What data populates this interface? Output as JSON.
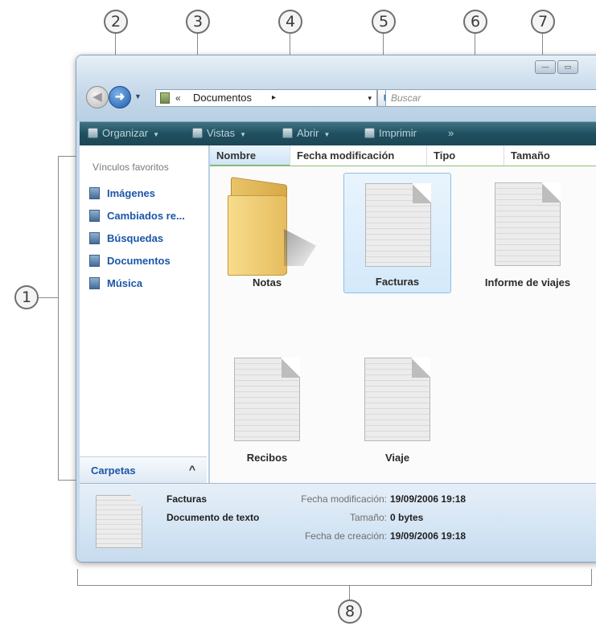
{
  "callouts": [
    "1",
    "2",
    "3",
    "4",
    "5",
    "6",
    "7",
    "8"
  ],
  "window": {
    "controls": {
      "minimize": "—",
      "maximize": "▭"
    }
  },
  "address_bar": {
    "chevron": "«",
    "path": "Documentos",
    "crumb_arrow": "▸",
    "dropdown": "▾"
  },
  "search": {
    "placeholder": "Buscar"
  },
  "toolbar": {
    "items": [
      "Organizar",
      "Vistas",
      "Abrir",
      "Imprimir"
    ],
    "overflow": "»"
  },
  "sidebar": {
    "heading": "Vínculos favoritos",
    "links": [
      "Imágenes",
      "Cambiados re...",
      "Búsquedas",
      "Documentos",
      "Música"
    ],
    "folders_label": "Carpetas",
    "collapse_glyph": "^"
  },
  "columns": [
    "Nombre",
    "Fecha modificación",
    "Tipo",
    "Tamaño"
  ],
  "files": [
    {
      "name": "Notas",
      "kind": "folder"
    },
    {
      "name": "Facturas",
      "kind": "document",
      "selected": true
    },
    {
      "name": "Informe de viajes",
      "kind": "document"
    },
    {
      "name": "Recibos",
      "kind": "document"
    },
    {
      "name": "Viaje",
      "kind": "document"
    }
  ],
  "details": {
    "name": "Facturas",
    "type": "Documento de texto",
    "modified_label": "Fecha modificación:",
    "modified_value": "19/09/2006 19:18",
    "size_label": "Tamaño:",
    "size_value": "0 bytes",
    "created_label": "Fecha de creación:",
    "created_value": "19/09/2006 19:18"
  }
}
